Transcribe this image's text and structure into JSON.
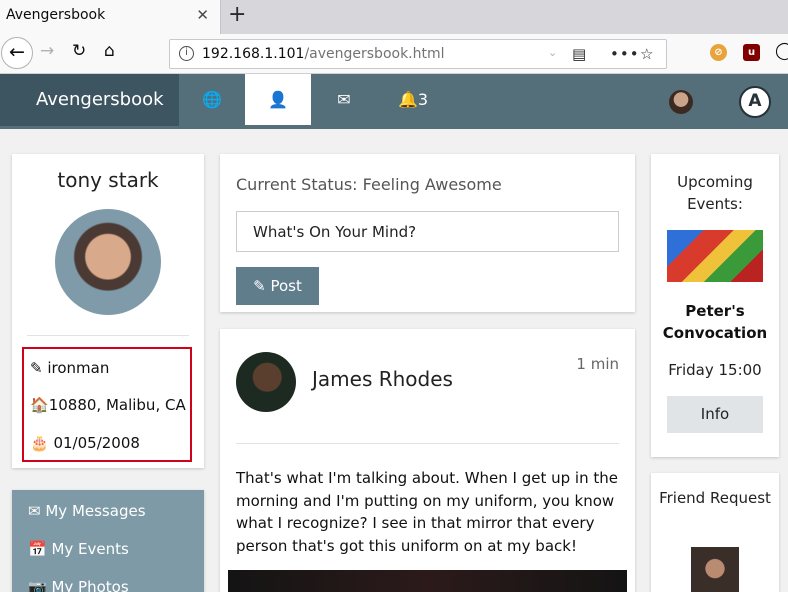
{
  "browser": {
    "tab_title": "Avengersbook",
    "tab_close": "✕",
    "new_tab": "+",
    "url_host": "192.168.1.101",
    "url_path": "/avengersbook.html",
    "icons": [
      "back-icon",
      "forward-icon",
      "reload-icon",
      "home-icon",
      "info-icon",
      "reader-icon",
      "more-icon",
      "bookmark-star-icon",
      "blocked-extension-icon",
      "ublock-icon",
      "account-icon"
    ]
  },
  "app": {
    "brand": "Avengersbook",
    "nav": [
      {
        "icon": "globe-icon",
        "glyph": "🌐"
      },
      {
        "icon": "user-icon",
        "glyph": "👤"
      },
      {
        "icon": "envelope-icon",
        "glyph": "✉"
      },
      {
        "icon": "notification-icon",
        "glyph": "🔔",
        "count": "3"
      }
    ],
    "accent": "#546e7a",
    "brand_bg": "#3d5561",
    "logo_letter": "A"
  },
  "profile": {
    "name": "tony stark",
    "username": "ironman",
    "address": "10880, Malibu, CA",
    "birthday": "01/05/2008",
    "username_icon": "✎",
    "address_icon": "🏠",
    "birthday_icon": "🎂"
  },
  "menu": {
    "items": [
      {
        "icon": "✉",
        "label": "My Messages"
      },
      {
        "icon": "📅",
        "label": "My Events"
      },
      {
        "icon": "📷",
        "label": "My Photos"
      }
    ]
  },
  "status": {
    "current": "Current Status: Feeling Awesome",
    "mind_value": "What's On Your Mind?",
    "post_label": "Post",
    "post_icon": "✎"
  },
  "post": {
    "author": "James Rhodes",
    "time": "1 min",
    "body": "That's what I'm talking about. When I get up in the morning and I'm putting on my uniform, you know what I recognize? I see in that mirror that every person that's got this uniform on at my back!"
  },
  "events": {
    "title": "Upcoming Events:",
    "name": "Peter's Convocation",
    "time": "Friday 15:00",
    "info_label": "Info"
  },
  "friend": {
    "title": "Friend Request"
  }
}
